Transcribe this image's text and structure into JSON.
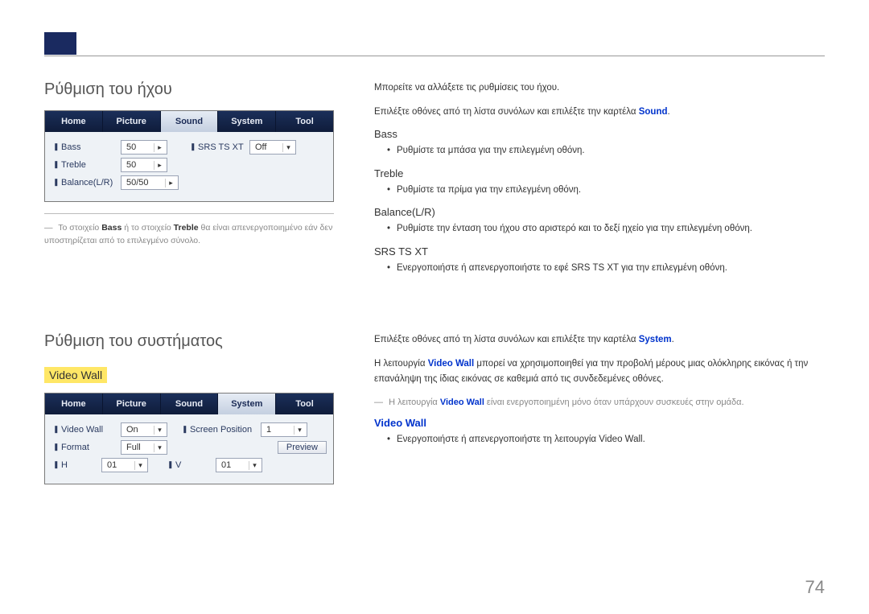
{
  "section_sound": {
    "title": "Ρύθμιση του ήχου",
    "panel": {
      "tabs": {
        "home": "Home",
        "picture": "Picture",
        "sound": "Sound",
        "system": "System",
        "tool": "Tool"
      },
      "rows": {
        "bass_label": "Bass",
        "bass_val": "50",
        "treble_label": "Treble",
        "treble_val": "50",
        "balance_label": "Balance(L/R)",
        "balance_val": "50/50",
        "srs_label": "SRS TS XT",
        "srs_val": "Off"
      }
    },
    "note_pre": "Το στοιχείο ",
    "note_bass": "Bass",
    "note_mid": " ή το στοιχείο ",
    "note_treble": "Treble",
    "note_post": " θα είναι απενεργοποιημένο εάν δεν υποστηρίζεται από το επιλεγμένο σύνολο.",
    "r_intro1": "Μπορείτε να αλλάξετε τις ρυθμίσεις του ήχου.",
    "r_intro2_pre": "Επιλέξτε οθόνες από τη λίστα συνόλων και επιλέξτε την καρτέλα ",
    "r_intro2_kw": "Sound",
    "r_intro2_post": ".",
    "h_bass": "Bass",
    "li_bass": "Ρυθμίστε τα μπάσα για την επιλεγμένη οθόνη.",
    "h_treble": "Treble",
    "li_treble": "Ρυθμίστε τα πρίμα για την επιλεγμένη οθόνη.",
    "h_balance": "Balance(L/R)",
    "li_balance": "Ρυθμίστε την ένταση του ήχου στο αριστερό και το δεξί ηχείο για την επιλεγμένη οθόνη.",
    "h_srs": "SRS TS XT",
    "li_srs_pre": "Ενεργοποιήστε ή απενεργοποιήστε το εφέ ",
    "li_srs_kw": "SRS TS XT",
    "li_srs_post": " για την επιλεγμένη οθόνη."
  },
  "section_system": {
    "title": "Ρύθμιση του συστήματος",
    "highlight": "Video Wall",
    "panel": {
      "tabs": {
        "home": "Home",
        "picture": "Picture",
        "sound": "Sound",
        "system": "System",
        "tool": "Tool"
      },
      "rows": {
        "vw_label": "Video Wall",
        "vw_val": "On",
        "sp_label": "Screen Position",
        "sp_val": "1",
        "fmt_label": "Format",
        "fmt_val": "Full",
        "preview": "Preview",
        "h_label": "H",
        "h_val": "01",
        "v_label": "V",
        "v_val": "01"
      }
    },
    "r_intro_pre": "Επιλέξτε οθόνες από τη λίστα συνόλων και επιλέξτε την καρτέλα ",
    "r_intro_kw": "System",
    "r_intro_post": ".",
    "r_desc_pre": "Η λειτουργία ",
    "r_desc_kw": "Video Wall",
    "r_desc_post": " μπορεί να χρησιμοποιηθεί για την προβολή μέρους μιας ολόκληρης εικόνας ή την επανάληψη της ίδιας εικόνας σε καθεμιά από τις συνδεδεμένες οθόνες.",
    "note_pre": "Η λειτουργία ",
    "note_kw": "Video Wall",
    "note_post": " είναι ενεργοποιημένη μόνο όταν υπάρχουν συσκευές στην ομάδα.",
    "h_vw": "Video Wall",
    "li_vw_pre": "Ενεργοποιήστε ή απενεργοποιήστε τη λειτουργία ",
    "li_vw_kw": "Video Wall",
    "li_vw_post": "."
  },
  "page_number": "74"
}
